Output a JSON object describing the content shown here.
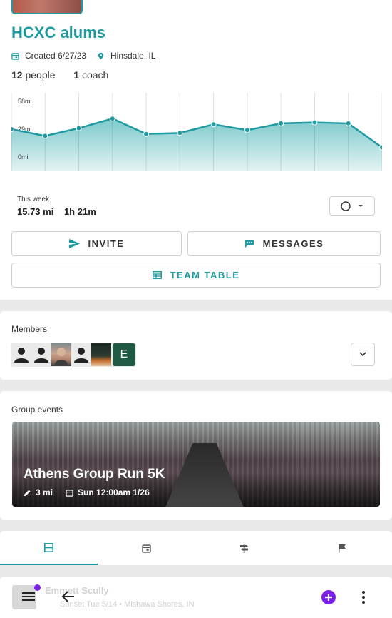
{
  "group": {
    "title": "HCXC alums",
    "created": "Created 6/27/23",
    "location": "Hinsdale, IL",
    "people_count": "12",
    "people_label": "people",
    "coach_count": "1",
    "coach_label": "coach"
  },
  "chart_data": {
    "type": "area",
    "ylabel": "",
    "y_ticks": [
      "58mi",
      "29mi",
      "0mi"
    ],
    "ylim": [
      0,
      58
    ],
    "grid": true,
    "values": [
      29,
      22,
      30,
      40,
      24,
      25,
      34,
      28,
      35,
      36,
      35,
      10
    ]
  },
  "week": {
    "label": "This week",
    "distance": "15.73 mi",
    "time": "1h 21m"
  },
  "buttons": {
    "invite": "INVITE",
    "messages": "MESSAGES",
    "team_table": "TEAM TABLE"
  },
  "members": {
    "label": "Members",
    "extra_initial": "E"
  },
  "events": {
    "label": "Group events",
    "title": "Athens Group Run 5K",
    "distance": "3 mi",
    "datetime": "Sun 12:00am 1/26"
  },
  "tabs": [
    {
      "icon": "feed-icon"
    },
    {
      "icon": "calendar-icon"
    },
    {
      "icon": "signpost-icon"
    },
    {
      "icon": "flag-icon"
    }
  ],
  "feed": {
    "name": "Emmett Scully",
    "subtitle": "Sunset Tue 5/14 • Mishawa Shores, IN"
  },
  "colors": {
    "accent": "#1e9aa0",
    "notification": "#7b1fe8",
    "member_e": "#1f5b43"
  }
}
